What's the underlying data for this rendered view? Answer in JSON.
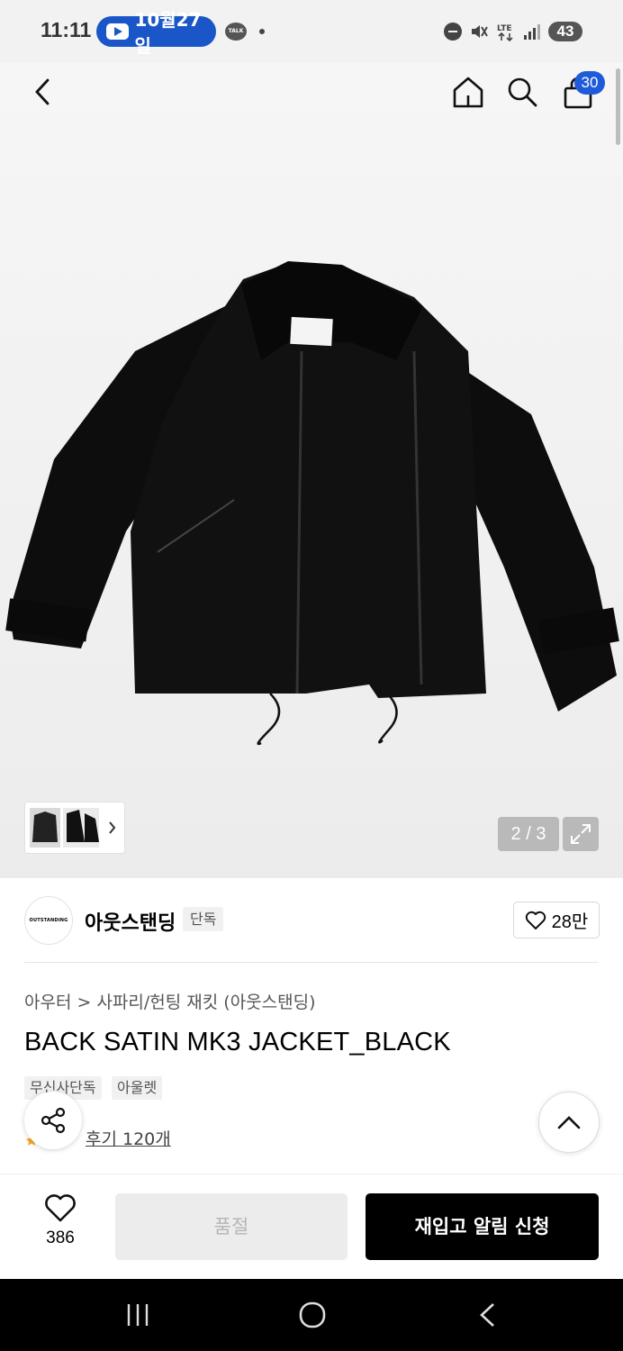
{
  "status_bar": {
    "time": "11:11",
    "notification": "10월27일",
    "talk_label": "TALK",
    "battery": "43"
  },
  "header": {
    "cart_count": "30"
  },
  "gallery": {
    "counter": "2 / 3"
  },
  "brand": {
    "logo_text": "OUTSTANDING",
    "name": "아웃스탠딩",
    "exclusive_badge": "단독",
    "likes": "28만"
  },
  "product": {
    "breadcrumb": "아우터 > 사파리/헌팅 재킷 (아웃스탠딩)",
    "title": "BACK SATIN MK3 JACKET_BLACK",
    "tags": [
      "무신사단독",
      "아울렛"
    ],
    "reviews": "후기 120개"
  },
  "bottom_bar": {
    "wish_count": "386",
    "soldout_label": "품절",
    "restock_label": "재입고 알림 신청"
  },
  "colors": {
    "accent_blue": "#1f5bd8",
    "dark": "#000000"
  }
}
